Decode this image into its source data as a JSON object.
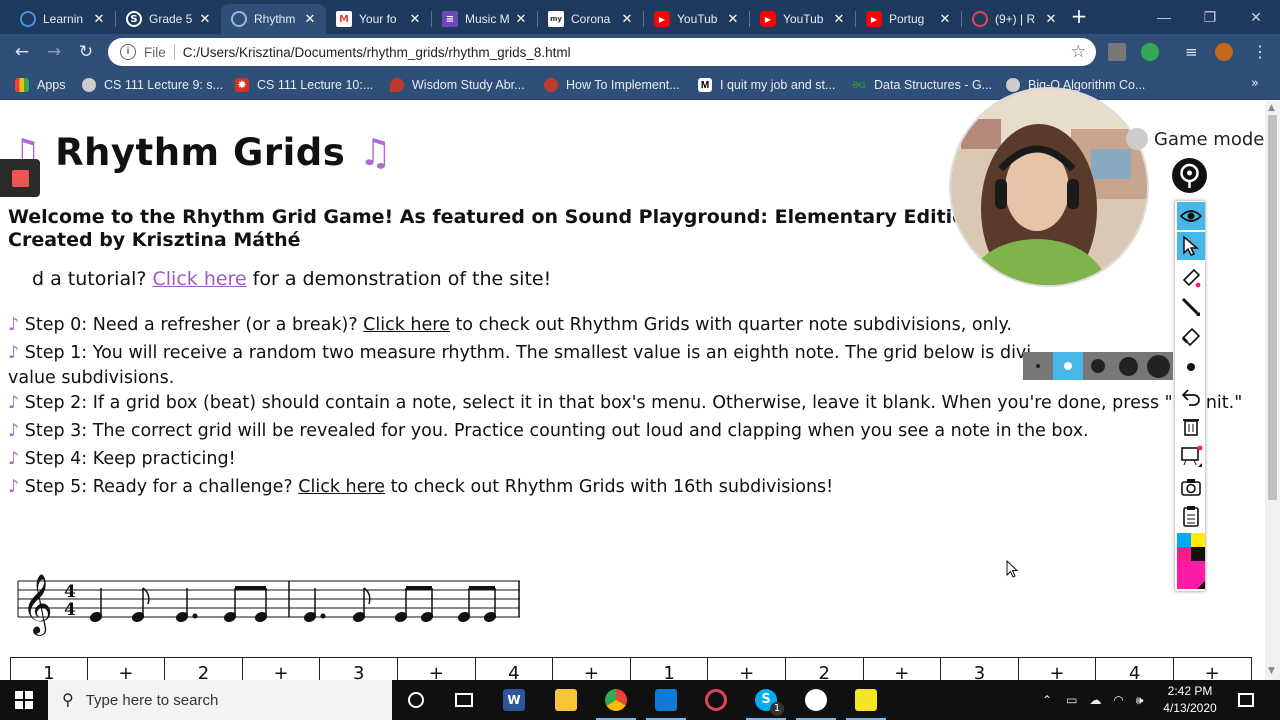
{
  "browser": {
    "tabs": [
      {
        "title": "Learnin",
        "icon": "globe-icon",
        "color": "#4a90e2"
      },
      {
        "title": "Grade 5",
        "icon": "s-icon",
        "color": "#ffffff"
      },
      {
        "title": "Rhythm",
        "icon": "globe-icon",
        "color": "#9db7d6"
      },
      {
        "title": "Your fo",
        "icon": "gmail-icon",
        "color": "#ea4335"
      },
      {
        "title": "Music M",
        "icon": "forms-icon",
        "color": "#7248b9"
      },
      {
        "title": "Corona",
        "icon": "page-icon",
        "color": "#ffffff"
      },
      {
        "title": "YouTub",
        "icon": "youtube-icon",
        "color": "#ff0000"
      },
      {
        "title": "YouTub",
        "icon": "youtube-icon",
        "color": "#ff0000"
      },
      {
        "title": "Portug",
        "icon": "youtube-icon",
        "color": "#ff0000"
      },
      {
        "title": "(9+) | R",
        "icon": "swirl-icon",
        "color": "#e0445a"
      }
    ],
    "url_scheme": "File",
    "url": "C:/Users/Krisztina/Documents/rhythm_grids/rhythm_grids_8.html",
    "bookmarks": [
      {
        "label": "Apps",
        "icon": "apps-grid-icon",
        "color": "#f4b400"
      },
      {
        "label": "CS 111 Lecture 9: s...",
        "icon": "globe-icon",
        "color": "#888888"
      },
      {
        "label": "CS 111 Lecture 10:...",
        "icon": "star-burst-icon",
        "color": "#d93025"
      },
      {
        "label": "Wisdom Study Abr...",
        "icon": "drop-icon",
        "color": "#c0392b"
      },
      {
        "label": "How To Implement...",
        "icon": "bird-icon",
        "color": "#c0392b"
      },
      {
        "label": "I quit my job and st...",
        "icon": "medium-icon",
        "color": "#000000"
      },
      {
        "label": "Data Structures - G...",
        "icon": "gg-icon",
        "color": "#2f8d46"
      },
      {
        "label": "Big-O Algorithm Co...",
        "icon": "globe-icon",
        "color": "#888888"
      }
    ],
    "bookmarks_more": "»"
  },
  "page": {
    "title": "Rhythm Grids",
    "title_note": "♫",
    "welcome_line1": "Welcome to the Rhythm Grid Game! As featured on Sound Playground: Elementary Edition",
    "welcome_line2": "Created by Krisztina Máthé",
    "tutorial_prefix": "d a tutorial? ",
    "tutorial_link": "Click here",
    "tutorial_suffix": " for a demonstration of the site!",
    "step_marker": "♪",
    "steps": [
      {
        "pre": " Step 0: Need a refresher (or a break)? ",
        "link": "Click here",
        "post": " to check out Rhythm Grids with quarter note subdivisions, only."
      },
      {
        "pre": " Step 1: You will receive a random two measure rhythm. The smallest value is an eighth note. The grid below is divi",
        "link": "",
        "post": ""
      },
      {
        "pre": "value subdivisions.",
        "link": "",
        "post": ""
      },
      {
        "pre": " Step 2: If a grid box (beat) should contain a note, select it in that box's menu. Otherwise, leave it blank. When you're done, press \"S",
        "link": "",
        "post": "nit.\""
      },
      {
        "pre": " Step 3: The correct grid will be revealed for you. Practice counting out loud and clapping when you see a note in the box.",
        "link": "",
        "post": ""
      },
      {
        "pre": " Step 4: Keep practicing!",
        "link": "",
        "post": ""
      },
      {
        "pre": " Step 5: Ready for a challenge? ",
        "link": "Click here",
        "post": " to check out Rhythm Grids with 16th subdivisions!"
      }
    ],
    "time_signature": {
      "top": "4",
      "bottom": "4"
    },
    "grid_counts": [
      "1",
      "+",
      "2",
      "+",
      "3",
      "+",
      "4",
      "+",
      "1",
      "+",
      "2",
      "+",
      "3",
      "+",
      "4",
      "+"
    ]
  },
  "overlay": {
    "game_mode_label": "Game mode",
    "tools": [
      "eye-icon",
      "cursor-icon",
      "marker-icon",
      "pen-icon",
      "eraser-icon",
      "dot-icon",
      "undo-icon",
      "trash-icon",
      "board-icon",
      "camera-icon",
      "clipboard-icon",
      "color-palette-icon"
    ],
    "accent": "#49b6e8"
  },
  "taskbar": {
    "search_placeholder": "Type here to search",
    "time": "2:42 PM",
    "date": "4/13/2020",
    "skype_badge": "1"
  }
}
